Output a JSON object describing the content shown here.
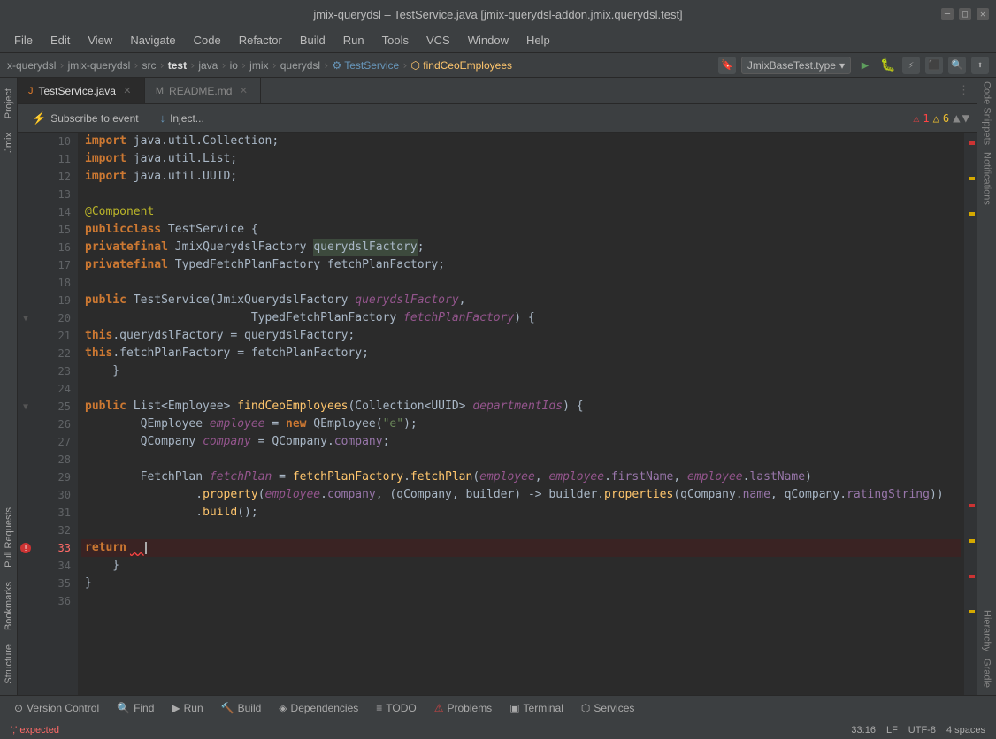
{
  "titleBar": {
    "title": "jmix-querydsl – TestService.java [jmix-querydsl-addon.jmix.querydsl.test]"
  },
  "menu": {
    "items": [
      "File",
      "Edit",
      "View",
      "Navigate",
      "Code",
      "Refactor",
      "Build",
      "Run",
      "Tools",
      "VCS",
      "Window",
      "Help"
    ]
  },
  "breadcrumbs": [
    {
      "label": "x-querydsl",
      "type": "normal"
    },
    {
      "label": "jmix-querydsl",
      "type": "normal"
    },
    {
      "label": "src",
      "type": "normal"
    },
    {
      "label": "test",
      "type": "bold"
    },
    {
      "label": "java",
      "type": "normal"
    },
    {
      "label": "io",
      "type": "normal"
    },
    {
      "label": "jmix",
      "type": "normal"
    },
    {
      "label": "querydsl",
      "type": "normal"
    },
    {
      "label": "TestService",
      "type": "class"
    },
    {
      "label": "findCeoEmployees",
      "type": "method"
    }
  ],
  "configDropdown": "JmixBaseTest.type",
  "tabs": [
    {
      "label": "TestService.java",
      "active": true,
      "type": "java"
    },
    {
      "label": "README.md",
      "active": false,
      "type": "readme"
    }
  ],
  "toolbar": {
    "subscribeLabel": "Subscribe to event",
    "injectLabel": "Inject..."
  },
  "errorWarning": {
    "errorCount": "1",
    "warningCount": "6"
  },
  "code": {
    "lines": [
      {
        "num": "10",
        "content": "import java.util.Collection;",
        "tokens": [
          {
            "t": "kw",
            "v": "import"
          },
          {
            "t": "plain",
            "v": " java.util.Collection;"
          }
        ]
      },
      {
        "num": "11",
        "content": "import java.util.List;",
        "tokens": [
          {
            "t": "kw",
            "v": "import"
          },
          {
            "t": "plain",
            "v": " java.util.List;"
          }
        ]
      },
      {
        "num": "12",
        "content": "import java.util.UUID;",
        "tokens": [
          {
            "t": "kw",
            "v": "import"
          },
          {
            "t": "plain",
            "v": " java.util.UUID;"
          }
        ]
      },
      {
        "num": "13",
        "content": "",
        "tokens": []
      },
      {
        "num": "14",
        "content": "@Component",
        "tokens": [
          {
            "t": "ann",
            "v": "@Component"
          }
        ]
      },
      {
        "num": "15",
        "content": "public class TestService {",
        "tokens": [
          {
            "t": "kw",
            "v": "public"
          },
          {
            "t": "plain",
            "v": " "
          },
          {
            "t": "kw",
            "v": "class"
          },
          {
            "t": "plain",
            "v": " TestService {"
          }
        ]
      },
      {
        "num": "16",
        "content": "    private final JmixQuerydslFactory querydslFactory;",
        "tokens": [
          {
            "t": "indent",
            "v": "    "
          },
          {
            "t": "kw",
            "v": "private"
          },
          {
            "t": "plain",
            "v": " "
          },
          {
            "t": "kw",
            "v": "final"
          },
          {
            "t": "plain",
            "v": " JmixQuerydslFactory "
          },
          {
            "t": "highlight",
            "v": "querydslFactory"
          },
          {
            "t": "plain",
            "v": ";"
          }
        ]
      },
      {
        "num": "17",
        "content": "    private final TypedFetchPlanFactory fetchPlanFactory;",
        "tokens": [
          {
            "t": "indent",
            "v": "    "
          },
          {
            "t": "kw",
            "v": "private"
          },
          {
            "t": "plain",
            "v": " "
          },
          {
            "t": "kw",
            "v": "final"
          },
          {
            "t": "plain",
            "v": " TypedFetchPlanFactory fetchPlanFactory;"
          }
        ]
      },
      {
        "num": "18",
        "content": "",
        "tokens": []
      },
      {
        "num": "19",
        "content": "    public TestService(JmixQuerydslFactory querydslFactory,",
        "tokens": [
          {
            "t": "indent",
            "v": "    "
          },
          {
            "t": "kw",
            "v": "public"
          },
          {
            "t": "plain",
            "v": " TestService(JmixQuerydslFactory "
          },
          {
            "t": "param",
            "v": "querydslFactory"
          },
          {
            "t": "plain",
            "v": ","
          }
        ]
      },
      {
        "num": "20",
        "content": "                        TypedFetchPlanFactory fetchPlanFactory) {",
        "tokens": [
          {
            "t": "plain",
            "v": "                        TypedFetchPlanFactory "
          },
          {
            "t": "param",
            "v": "fetchPlanFactory"
          },
          {
            "t": "plain",
            "v": ") {"
          }
        ]
      },
      {
        "num": "21",
        "content": "        this.querydslFactory = querydslFactory;",
        "tokens": [
          {
            "t": "indent",
            "v": "        "
          },
          {
            "t": "kw",
            "v": "this"
          },
          {
            "t": "plain",
            "v": ".querydslFactory = querydslFactory;"
          }
        ]
      },
      {
        "num": "22",
        "content": "        this.fetchPlanFactory = fetchPlanFactory;",
        "tokens": [
          {
            "t": "indent",
            "v": "        "
          },
          {
            "t": "kw",
            "v": "this"
          },
          {
            "t": "plain",
            "v": ".fetchPlanFactory = fetchPlanFactory;"
          }
        ]
      },
      {
        "num": "23",
        "content": "    }",
        "tokens": [
          {
            "t": "indent",
            "v": "    "
          },
          {
            "t": "plain",
            "v": "}"
          }
        ]
      },
      {
        "num": "24",
        "content": "",
        "tokens": []
      },
      {
        "num": "25",
        "content": "    public List<Employee> findCeoEmployees(Collection<UUID> departmentIds) {",
        "tokens": [
          {
            "t": "indent",
            "v": "    "
          },
          {
            "t": "kw",
            "v": "public"
          },
          {
            "t": "plain",
            "v": " List<Employee> "
          },
          {
            "t": "fn",
            "v": "findCeoEmployees"
          },
          {
            "t": "plain",
            "v": "(Collection<UUID> "
          },
          {
            "t": "param",
            "v": "departmentIds"
          },
          {
            "t": "plain",
            "v": ") {"
          }
        ]
      },
      {
        "num": "26",
        "content": "        QEmployee employee = new QEmployee(\"e\");",
        "tokens": [
          {
            "t": "indent",
            "v": "        "
          },
          {
            "t": "plain",
            "v": "QEmployee "
          },
          {
            "t": "param",
            "v": "employee"
          },
          {
            "t": "plain",
            "v": " = "
          },
          {
            "t": "kw",
            "v": "new"
          },
          {
            "t": "plain",
            "v": " QEmployee("
          },
          {
            "t": "str",
            "v": "\"e\""
          },
          {
            "t": "plain",
            "v": ");"
          }
        ]
      },
      {
        "num": "27",
        "content": "        QCompany company = QCompany.company;",
        "tokens": [
          {
            "t": "indent",
            "v": "        "
          },
          {
            "t": "plain",
            "v": "QCompany "
          },
          {
            "t": "param",
            "v": "company"
          },
          {
            "t": "plain",
            "v": " = QCompany."
          },
          {
            "t": "field",
            "v": "company"
          },
          {
            "t": "plain",
            "v": ";"
          }
        ]
      },
      {
        "num": "28",
        "content": "",
        "tokens": []
      },
      {
        "num": "29",
        "content": "        FetchPlan fetchPlan = fetchPlanFactory.fetchPlan(employee, employee.firstName, employee.lastName)",
        "tokens": [
          {
            "t": "indent",
            "v": "        "
          },
          {
            "t": "plain",
            "v": "FetchPlan "
          },
          {
            "t": "param",
            "v": "fetchPlan"
          },
          {
            "t": "plain",
            "v": " = "
          },
          {
            "t": "fn",
            "v": "fetchPlanFactory"
          },
          {
            "t": "plain",
            "v": "."
          },
          {
            "t": "fn",
            "v": "fetchPlan"
          },
          {
            "t": "plain",
            "v": "("
          },
          {
            "t": "param",
            "v": "employee"
          },
          {
            "t": "plain",
            "v": ", "
          },
          {
            "t": "param",
            "v": "employee"
          },
          {
            "t": "plain",
            "v": "."
          },
          {
            "t": "field",
            "v": "firstName"
          },
          {
            "t": "plain",
            "v": ", "
          },
          {
            "t": "param",
            "v": "employee"
          },
          {
            "t": "plain",
            "v": "."
          },
          {
            "t": "field",
            "v": "lastName"
          },
          {
            "t": "plain",
            "v": ")"
          }
        ]
      },
      {
        "num": "30",
        "content": "                .property(employee.company, (qCompany, builder) -> builder.properties(qCompany.name, qCompany.ratingString))",
        "tokens": [
          {
            "t": "plain",
            "v": "                ."
          },
          {
            "t": "fn",
            "v": "property"
          },
          {
            "t": "plain",
            "v": "("
          },
          {
            "t": "param",
            "v": "employee"
          },
          {
            "t": "plain",
            "v": "."
          },
          {
            "t": "field",
            "v": "company"
          },
          {
            "t": "plain",
            "v": ", (qCompany, builder) -> builder."
          },
          {
            "t": "fn",
            "v": "properties"
          },
          {
            "t": "plain",
            "v": "(qCompany."
          },
          {
            "t": "field",
            "v": "name"
          },
          {
            "t": "plain",
            "v": ", qCompany."
          },
          {
            "t": "field",
            "v": "ratingString"
          },
          {
            "t": "plain",
            "v": "))"
          }
        ]
      },
      {
        "num": "31",
        "content": "                .build();",
        "tokens": [
          {
            "t": "plain",
            "v": "                ."
          },
          {
            "t": "fn",
            "v": "build"
          },
          {
            "t": "plain",
            "v": "();"
          }
        ]
      },
      {
        "num": "32",
        "content": "",
        "tokens": []
      },
      {
        "num": "33",
        "content": "        return",
        "tokens": [
          {
            "t": "indent",
            "v": "        "
          },
          {
            "t": "kw",
            "v": "return"
          },
          {
            "t": "plain",
            "v": "  "
          }
        ],
        "error": true,
        "cursor": true
      },
      {
        "num": "34",
        "content": "    }",
        "tokens": [
          {
            "t": "indent",
            "v": "    "
          },
          {
            "t": "plain",
            "v": "}"
          }
        ]
      },
      {
        "num": "35",
        "content": "}",
        "tokens": [
          {
            "t": "plain",
            "v": "}"
          }
        ]
      },
      {
        "num": "36",
        "content": "",
        "tokens": []
      }
    ]
  },
  "bottomToolbar": {
    "items": [
      "Version Control",
      "Find",
      "Run",
      "Build",
      "Dependencies",
      "TODO",
      "Problems",
      "Terminal",
      "Services"
    ]
  },
  "statusBar": {
    "position": "33:16",
    "lineSeparator": "LF",
    "encoding": "UTF-8",
    "indent": "4 spaces",
    "error": "';' expected"
  },
  "leftPanels": [
    "Project",
    "Jmix",
    "Pull Requests",
    "Bookmarks",
    "Structure"
  ],
  "rightPanels": [
    "Code Snippets",
    "Notifications",
    "Hierarchy",
    "Gradle"
  ]
}
